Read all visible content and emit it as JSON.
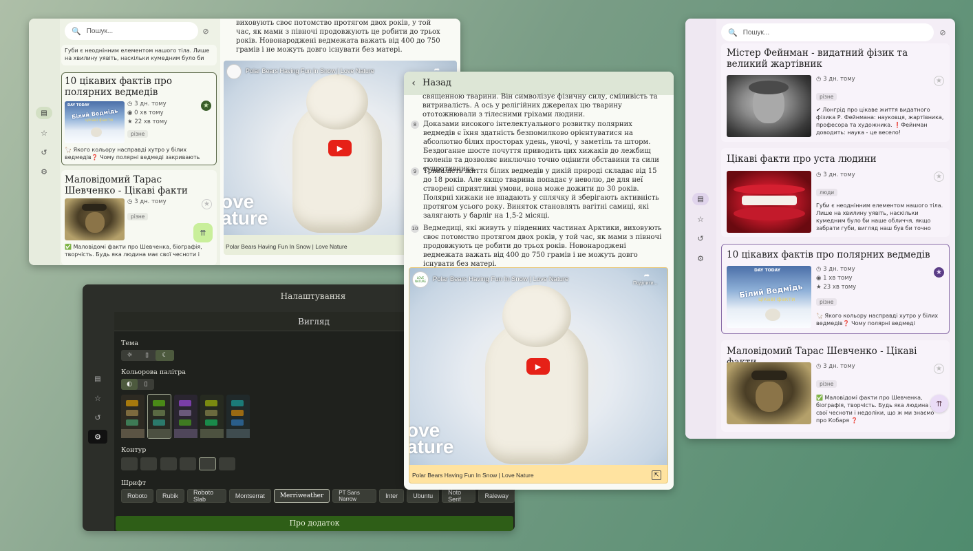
{
  "search": {
    "placeholder": "Пошук..."
  },
  "green_window": {
    "cards": [
      {
        "title": "",
        "desc": "Губи є неоднінним елементом нашого тіла. Лише на хвилину уявіть, наскільки кумедним було би наше ..."
      },
      {
        "title": "10 цікавих фактів про полярних ведмедів",
        "meta": [
          "3 дн. тому",
          "0 хв тому",
          "22 хв тому"
        ],
        "tag": "різне",
        "desc": "🦙 Якого кольору насправді хутро у білих ведмедів❓ Чому полярні ведмеді закривають носа лапами❓ Ці..."
      },
      {
        "title": "Маловідомий Тарас Шевченко - Цікаві факти",
        "meta": [
          "3 дн. тому"
        ],
        "tag": "різне",
        "desc": "✅ Маловідомі факти про Шевченка, біографія, творчість. Будь яка людина має свої чесноти і недол..."
      }
    ],
    "thumb_text": {
      "line1": "Білий Ведмідь",
      "line2": "цікаві факти",
      "badge": "DAY TODAY"
    },
    "article_text": "виховують своє потомство протягом двох років, у той час, як мами з півночі продовжують це робити до трьох років. Новонароджені ведмежата важать від 400 до 750 грамів і не можуть довго існувати без матері.",
    "video_title": "Polar Bears Having Fun In Snow | Love Nature",
    "video_caption": "Polar Bears Having Fun In Snow | Love Nature",
    "watermark": "ove\nature"
  },
  "middle_window": {
    "back_label": "Назад",
    "intro": "священною тварини. Він символізує фізичну силу, сміливість та витривалість. А ось у релігійних джерелах цю тварину ототожнювали з тілесними гріхами людини.",
    "items": [
      {
        "n": "8",
        "text": "Доказами високого інтелектуального розвитку полярних ведмедів є їхня здатність безпомилково орієнтуватися на абсолютно білих просторах удень, уночі, у заметіль та шторм. Бездоганне шосте почуття приводить цих хижаків до лежбищ тюленів та дозволяє виключно точно оцінити обставини та сили супротивника."
      },
      {
        "n": "9",
        "text": "Тривалість життя білих ведмедів у дикій природі складає від 15 до 18 років. Але якщо тварина попадає у неволю, де для неї створені сприятливі умови, вона може дожити до 30 років. Полярні хижаки не впадають у сплячку й зберігають активність протягом усього року. Виняток становлять вагітні самиці, які залягають у барліг на 1,5-2 місяці."
      },
      {
        "n": "10",
        "text": "Ведмедиці, які живуть у південних частинах Арктики, виховують своє потомство протягом двох років, у той час, як мами з півночі продовжують це робити до трьох років. Новонароджені ведмежата важать від 400 до 750 грамів і не можуть довго існувати без матері."
      }
    ],
    "video_title": "Polar Bears Having Fun In Snow | Love Nature",
    "share_label": "Поділити...",
    "video_caption": "Polar Bears Having Fun In Snow | Love Nature",
    "watermark": "ove\nature",
    "logo_text": "LOVE NATURE"
  },
  "settings": {
    "title": "Налаштування",
    "section": "Вигляд",
    "theme_label": "Тема",
    "palette_label": "Кольорова палітра",
    "outline_label": "Контур",
    "font_label": "Шрифт",
    "fonts": [
      "Roboto",
      "Rubik",
      "Roboto Slab",
      "Montserrat",
      "Merriweather",
      "PT Sans Narrow",
      "Inter",
      "Ubuntu",
      "Noto Serif",
      "Raleway"
    ],
    "about_label": "Про додаток"
  },
  "right_window": {
    "cards": [
      {
        "title": "Містер Фейнман - видатний фізик та великий жартівник",
        "meta": [
          "3 дн. тому"
        ],
        "tag": "різне",
        "desc": "✔ Лонгрід про цікаве життя видатного фізика Р. Фейнмана: науковця, жартівника, професора та художника. ❗Фейнман доводить: наука - це весело!"
      },
      {
        "title": "Цікаві факти про уста людини",
        "meta": [
          "3 дн. тому"
        ],
        "tag": "люди",
        "desc": "Губи є неоднінним елементом нашого тіла. Лише на хвилину уявіть, наскільки кумедним було би наше обличчя, якщо забрати губи, вигляд наш був би точно які..."
      },
      {
        "title": "10 цікавих фактів про полярних ведмедів",
        "meta": [
          "3 дн. тому",
          "1 хв тому",
          "23 хв тому"
        ],
        "tag": "різне",
        "desc": "🦙 Якого кольору насправді хутро у білих ведмедів❓ Чому полярні ведмеді закриваю..."
      },
      {
        "title": "Маловідомий Тарас Шевченко - Цікаві факти",
        "meta": [
          "3 дн. тому"
        ],
        "tag": "різне",
        "desc": "✅ Маловідомі факти про Шевченка, біографія, творчість. Будь яка людина має свої чесноти і недоліки, що ж ми знаємо про Кобаря ❓"
      }
    ],
    "thumb_text": {
      "line1": "Білий Ведмідь",
      "line2": "цікаві факти",
      "badge": "DAY TODAY"
    }
  },
  "colors": {
    "green_bg": "#eef2e6",
    "lilac_bg": "#f4eef6",
    "dark_bg": "#1f211d",
    "video_yellow": "#ffe3a0",
    "accent_green": "#3a5e2a",
    "accent_purple": "#5b3d86"
  }
}
